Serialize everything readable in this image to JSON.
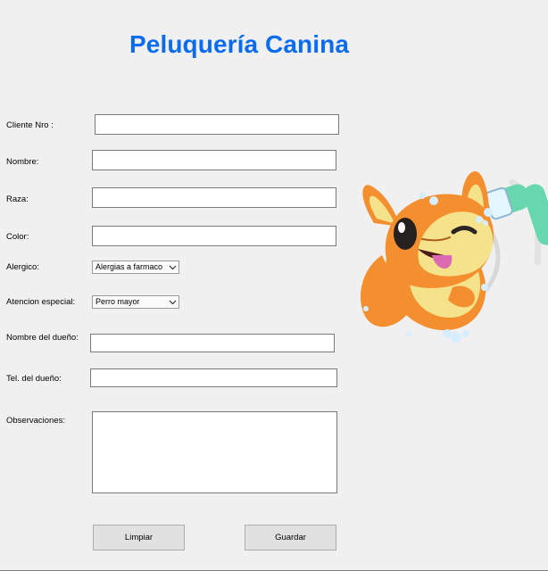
{
  "title": "Peluquería Canina",
  "labels": {
    "cliente": "Cliente Nro :",
    "nombre": "Nombre:",
    "raza": "Raza:",
    "color": "Color:",
    "alergico": "Alergico:",
    "atencion": "Atencion especial:",
    "dueno": "Nombre del dueño:",
    "tel": "Tel. del dueño:",
    "observaciones": "Observaciones:"
  },
  "fields": {
    "cliente": "",
    "nombre": "",
    "raza": "",
    "color": "",
    "dueno": "",
    "tel": "",
    "observaciones": ""
  },
  "selects": {
    "alergico": "Alergias a farmaco",
    "atencion": "Perro mayor"
  },
  "buttons": {
    "limpiar": "Limpiar",
    "guardar": "Guardar"
  },
  "colors": {
    "title": "#0b6cf0",
    "dog_orange": "#f48f2f",
    "dog_cream": "#f5e38c",
    "shower": "#67d8ae"
  },
  "icons": {
    "dropdown": "chevron-down-icon",
    "mascot": "dog-bath-mascot-icon"
  }
}
